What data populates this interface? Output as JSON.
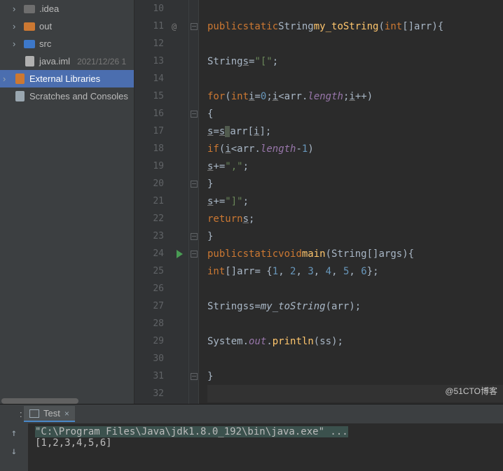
{
  "tree": {
    "idea": ".idea",
    "out": "out",
    "src": "src",
    "iml": "java.iml",
    "iml_date": "2021/12/26 1",
    "ext_libs": "External Libraries",
    "scratches": "Scratches and Consoles"
  },
  "gutter": [
    "10",
    "11",
    "12",
    "13",
    "14",
    "15",
    "16",
    "17",
    "18",
    "19",
    "20",
    "21",
    "22",
    "23",
    "24",
    "25",
    "26",
    "27",
    "28",
    "29",
    "30",
    "31",
    "32"
  ],
  "code": {
    "kw_public": "public",
    "kw_static": "static",
    "kw_void": "void",
    "kw_for": "for",
    "kw_if": "if",
    "kw_return": "return",
    "kw_int": "int",
    "t_String": "String",
    "n_my_toString": "my_toString",
    "n_main": "main",
    "n_args": "args",
    "n_arr": "arr",
    "n_s": "s",
    "n_ss": "ss",
    "n_i": "i",
    "str_open": "\"[\"",
    "str_close": "\"]\"",
    "str_comma": "\",\"",
    "lit_0": "0",
    "lit_1": "1",
    "lit_a": "1",
    "lit_b": "2",
    "lit_c": "3",
    "lit_d": "4",
    "lit_e": "5",
    "lit_f": "6",
    "f_length": "length",
    "f_out": "out",
    "f_println": "println",
    "sys": "System",
    "vcs_at": "@"
  },
  "tab": {
    "label": "Test",
    "close": "×"
  },
  "console": {
    "cmd": "\"C:\\Program Files\\Java\\jdk1.8.0_192\\bin\\java.exe\" ...",
    "out": "[1,2,3,4,5,6]"
  },
  "credit": "@51CTO博客"
}
